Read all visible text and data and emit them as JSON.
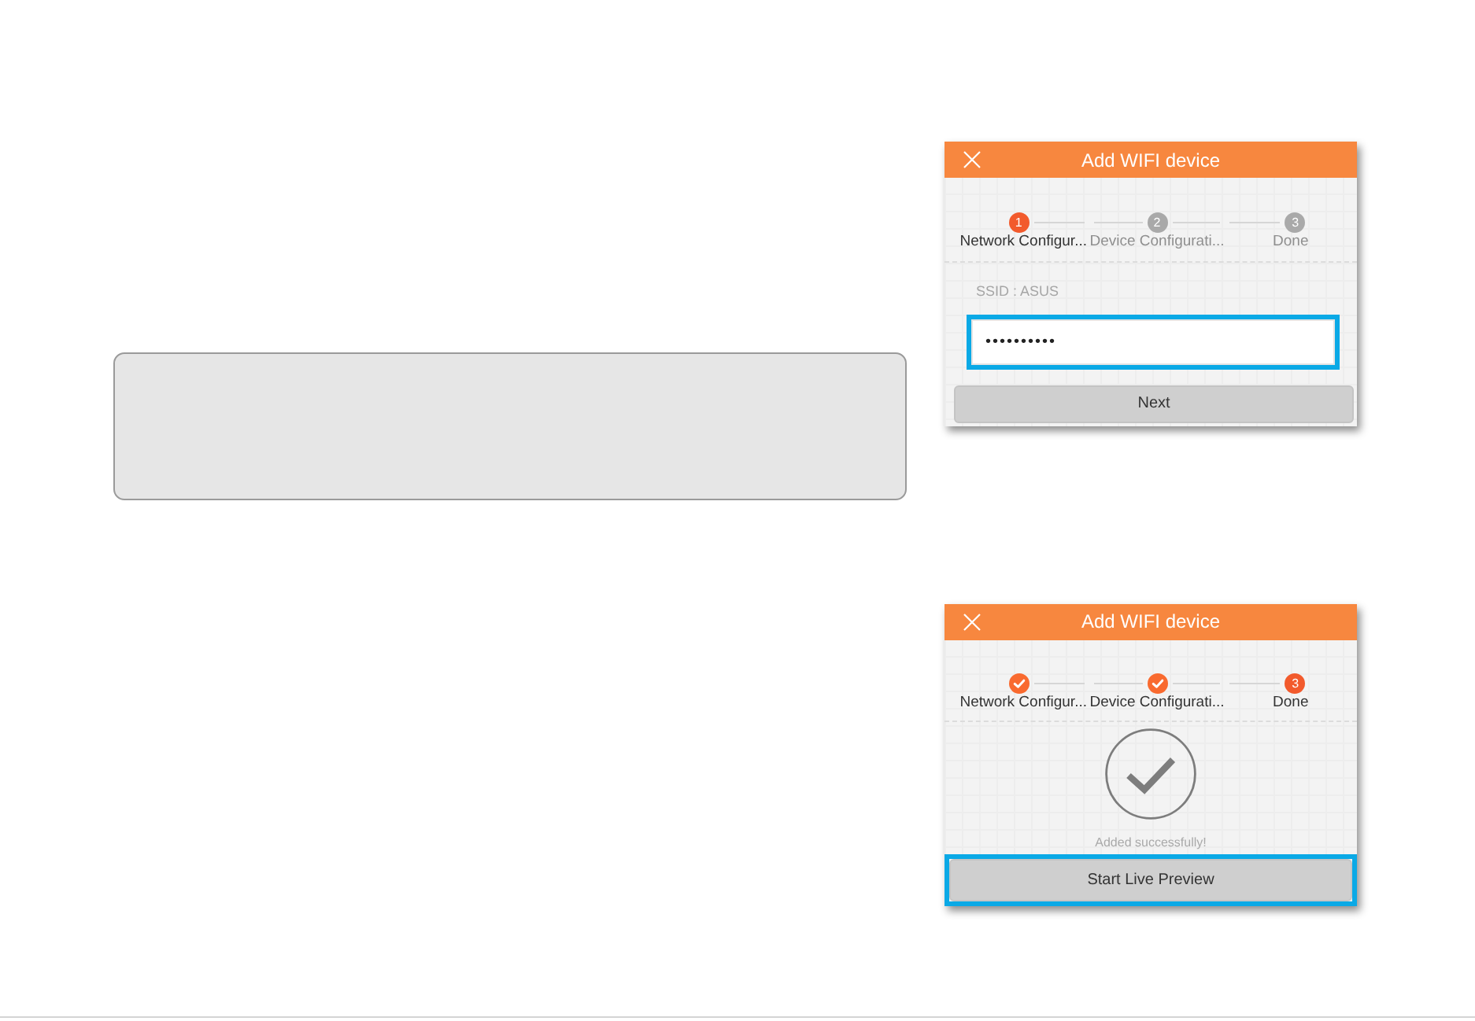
{
  "screens": [
    {
      "kind": "password_entry",
      "title": "Add WIFI device",
      "steps": [
        {
          "number": "1",
          "label": "Network Configur...",
          "active": true,
          "done": false
        },
        {
          "number": "2",
          "label": "Device Configurati...",
          "active": false,
          "done": false
        },
        {
          "number": "3",
          "label": "Done",
          "active": false,
          "done": false
        }
      ],
      "ssid_label": "SSID : ASUS",
      "password": {
        "value": "••••••••••",
        "highlighted": true
      },
      "button": {
        "label": "Next",
        "highlighted": false
      }
    },
    {
      "kind": "success",
      "title": "Add WIFI device",
      "steps": [
        {
          "label": "Network Configur...",
          "active": false,
          "done": true
        },
        {
          "label": "Device Configurati...",
          "active": false,
          "done": true
        },
        {
          "number": "3",
          "label": "Done",
          "active": true,
          "done": false
        }
      ],
      "message": "Added successfully!",
      "button": {
        "label": "Start Live Preview",
        "highlighted": true
      }
    }
  ]
}
